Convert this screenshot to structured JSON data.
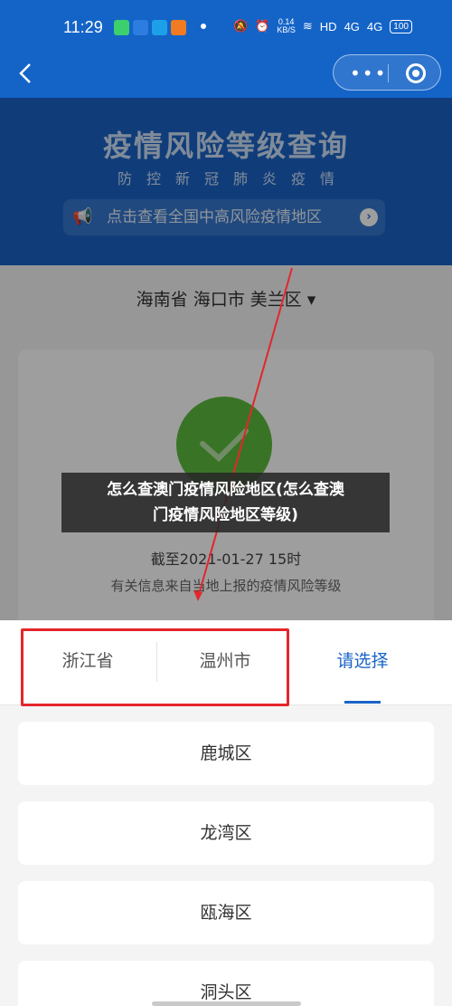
{
  "status_bar": {
    "time": "11:29",
    "network_speed_value": "0.14",
    "network_speed_unit": "KB/S",
    "hd_label": "HD",
    "signal_1": "4G",
    "signal_2": "4G",
    "battery": "100",
    "notification_colors": [
      "#3ccf6e",
      "#2d7de0",
      "#1ea0e8",
      "#f07b22"
    ]
  },
  "nav": {
    "back_icon": "chevron-left-icon",
    "more_icon": "more-icon",
    "close_icon": "target-circle-icon"
  },
  "hero": {
    "title": "疫情风险等级查询",
    "subtitle": "防控新冠肺炎疫情",
    "link_text": "点击查看全国中高风险疫情地区",
    "link_icon": "speaker-icon"
  },
  "region_selector": {
    "label": "海南省 海口市 美兰区",
    "caret": "▾"
  },
  "status_card": {
    "icon": "check-icon",
    "icon_color": "#5dbb3e",
    "cutoff_text": "截至2021-01-27 15时",
    "source_text": "有关信息来自当地上报的疫情风险等级"
  },
  "caption": {
    "line1": "怎么查澳门疫情风险地区(怎么查澳",
    "line2": "门疫情风险地区等级)"
  },
  "picker": {
    "tabs": [
      {
        "label": "浙江省",
        "active": false
      },
      {
        "label": "温州市",
        "active": false
      },
      {
        "label": "请选择",
        "active": true
      }
    ],
    "options": [
      "鹿城区",
      "龙湾区",
      "瓯海区",
      "洞头区"
    ],
    "accent_color": "#1a63c6",
    "highlight_color": "#e4262b"
  }
}
